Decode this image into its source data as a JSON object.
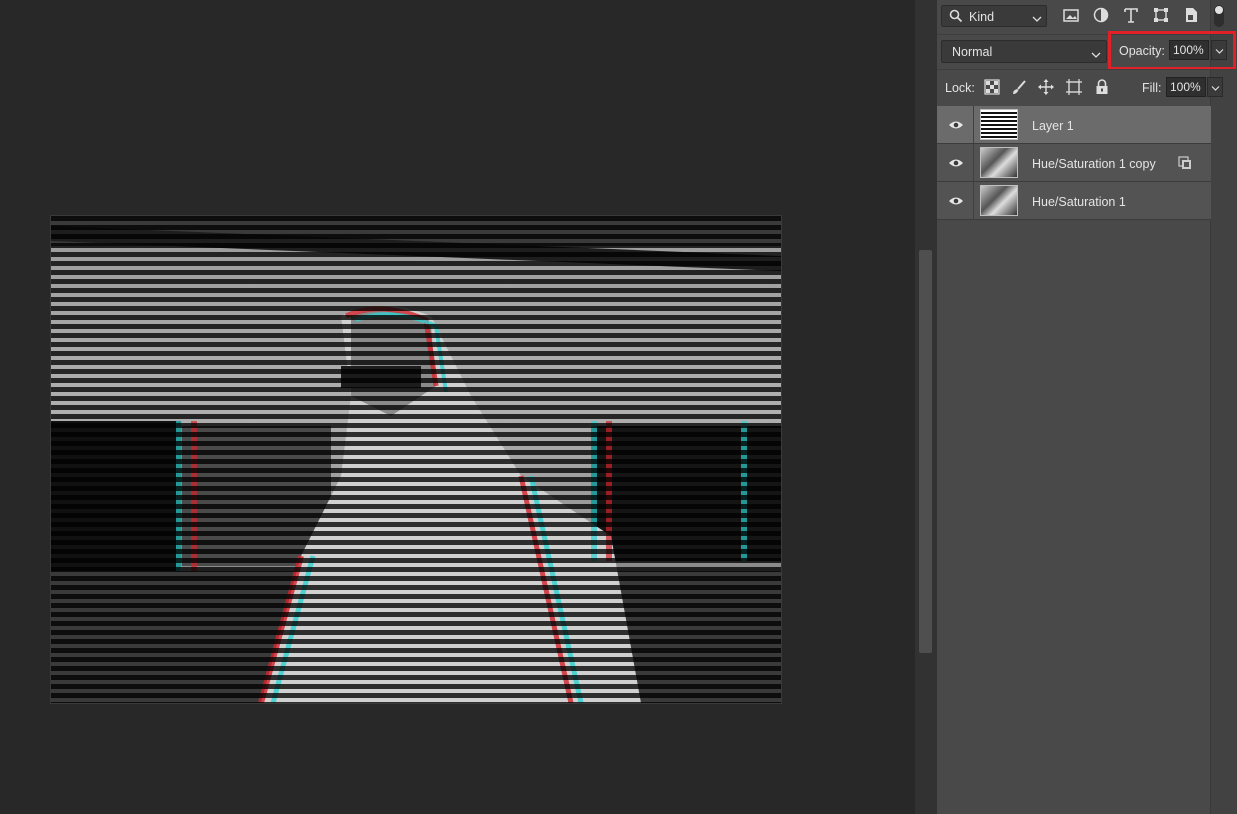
{
  "layers_panel": {
    "filter": {
      "label": "Kind",
      "icons": [
        "image-filter-icon",
        "adjustment-filter-icon",
        "type-filter-icon",
        "shape-filter-icon",
        "smart-object-filter-icon"
      ]
    },
    "blend_mode": "Normal",
    "opacity": {
      "label": "Opacity:",
      "value": "100%"
    },
    "lock": {
      "label": "Lock:",
      "icons": [
        "lock-transparent-pixels-icon",
        "lock-image-pixels-icon",
        "lock-position-icon",
        "lock-artboard-icon",
        "lock-all-icon"
      ]
    },
    "fill": {
      "label": "Fill:",
      "value": "100%"
    },
    "layers": [
      {
        "name": "Layer 1",
        "visible": true,
        "selected": true,
        "thumb": "stripes",
        "smart_object": false
      },
      {
        "name": "Hue/Saturation 1 copy",
        "visible": true,
        "selected": false,
        "thumb": "photo",
        "smart_object": true
      },
      {
        "name": "Hue/Saturation 1",
        "visible": true,
        "selected": false,
        "thumb": "photo",
        "smart_object": false
      }
    ]
  },
  "colors": {
    "highlight": "#e02128",
    "canvas_bg": "#282828",
    "panel_bg": "#494949",
    "selected_row": "#6b6b6b"
  }
}
